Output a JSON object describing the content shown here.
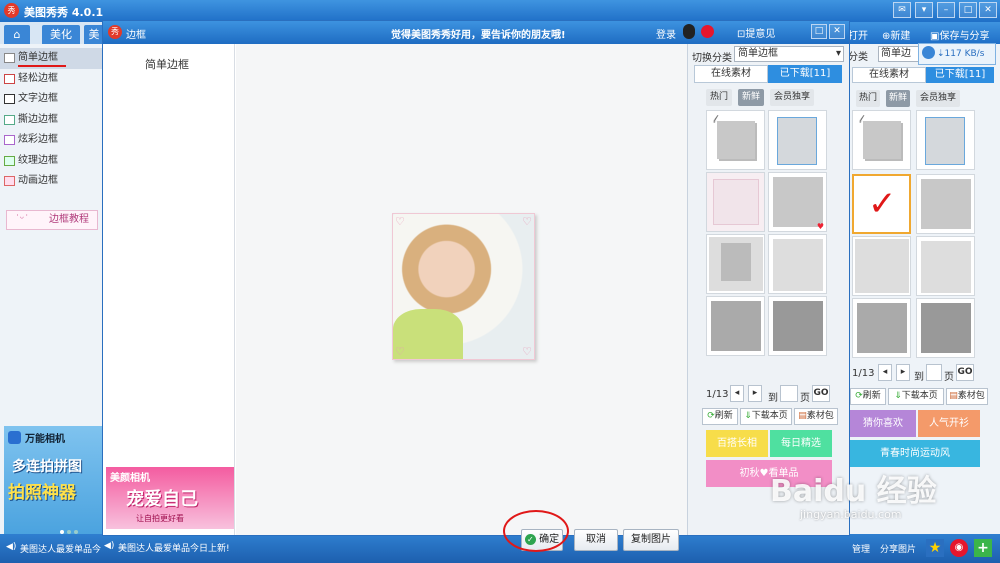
{
  "app": {
    "title": "美图秀秀 4.0.1",
    "logo_text": "秀",
    "top_right": {
      "open": "打开",
      "new": "新建",
      "save_share": "保存与分享",
      "speed": "117 KB/s"
    }
  },
  "left": {
    "tabs": [
      "美化",
      "美"
    ],
    "items": [
      "简单边框",
      "轻松边框",
      "文字边框",
      "撕边边框",
      "炫彩边框",
      "纹理边框",
      "动画边框"
    ],
    "tutorial": "边框教程",
    "camera_ad": {
      "title": "万能相机",
      "line1": "多连拍拼图",
      "line2": "拍照神器"
    }
  },
  "dialog": {
    "title": "边框",
    "banner": "觉得美图秀秀好用，要告诉你的朋友哦!",
    "login": "登录",
    "feedback": "提意见",
    "left_heading": "简单边框",
    "ad": {
      "brand": "美颜相机",
      "slogan": "宠爱自己",
      "sub": "让自拍更好看"
    },
    "buttons": {
      "ok": "确定",
      "cancel": "取消",
      "copy": "复制图片"
    },
    "side": {
      "category_label": "切换分类",
      "category_value": "简单边框",
      "tab_online": "在线素材",
      "tab_downloaded": "已下载[11]",
      "filters": [
        "热门",
        "新鲜",
        "会员独享"
      ],
      "pager": {
        "page": "1/13",
        "to": "到",
        "unit": "页",
        "go": "GO"
      },
      "actions": [
        "刷新",
        "下载本页",
        "素材包"
      ],
      "colored": [
        "百搭长相",
        "每日精选",
        "初秋♥看单品"
      ]
    }
  },
  "right_panel": {
    "category_label": "分类",
    "category_value": "简单边",
    "tab_online": "在线素材",
    "tab_downloaded": "已下载[11]",
    "filters": [
      "热门",
      "新鲜",
      "会员独享"
    ],
    "pager": {
      "page": "1/13",
      "to": "到",
      "unit": "页",
      "go": "GO"
    },
    "actions": [
      "刷新",
      "下载本页",
      "素材包"
    ],
    "colored": [
      "猜你喜欢",
      "人气开衫",
      "青春时尚运动风"
    ]
  },
  "status": {
    "left_text": "美图达人最爱单品今",
    "dialog_text": "美图达人最爱单品今日上新!",
    "manage": "管理",
    "share": "分享图片"
  },
  "watermark": {
    "text": "Baidu 经验",
    "url": "jingyan.baidu.com"
  }
}
